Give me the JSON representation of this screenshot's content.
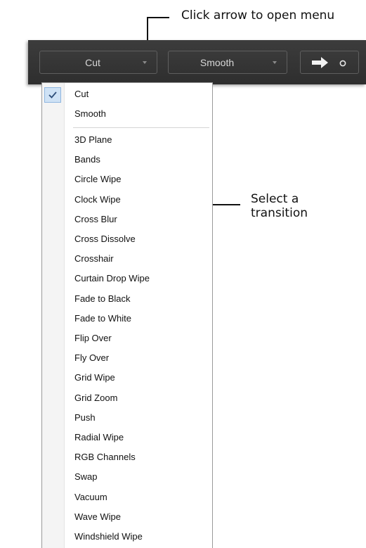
{
  "callouts": {
    "top": "Click arrow to open menu",
    "right_line1": "Select a",
    "right_line2": "transition"
  },
  "toolbar": {
    "transition_select": {
      "value": "Cut",
      "icon": "chevron-down-icon"
    },
    "easing_select": {
      "value": "Smooth",
      "icon": "chevron-down-icon"
    },
    "direction_button": {
      "icon": "arrow-right-icon"
    }
  },
  "menu": {
    "checked_item": "Cut",
    "group1": [
      "Cut",
      "Smooth"
    ],
    "group2": [
      "3D Plane",
      "Bands",
      "Circle Wipe",
      "Clock Wipe",
      "Cross Blur",
      "Cross Dissolve",
      "Crosshair",
      "Curtain Drop Wipe",
      "Fade to Black",
      "Fade to White",
      "Flip Over",
      "Fly Over",
      "Grid Wipe",
      "Grid Zoom",
      "Push",
      "Radial Wipe",
      "RGB Channels",
      "Swap",
      "Vacuum",
      "Wave Wipe",
      "Windshield Wipe"
    ]
  },
  "colors": {
    "toolbar_bg": "#333333",
    "check_highlight": "#cfe2f5"
  }
}
